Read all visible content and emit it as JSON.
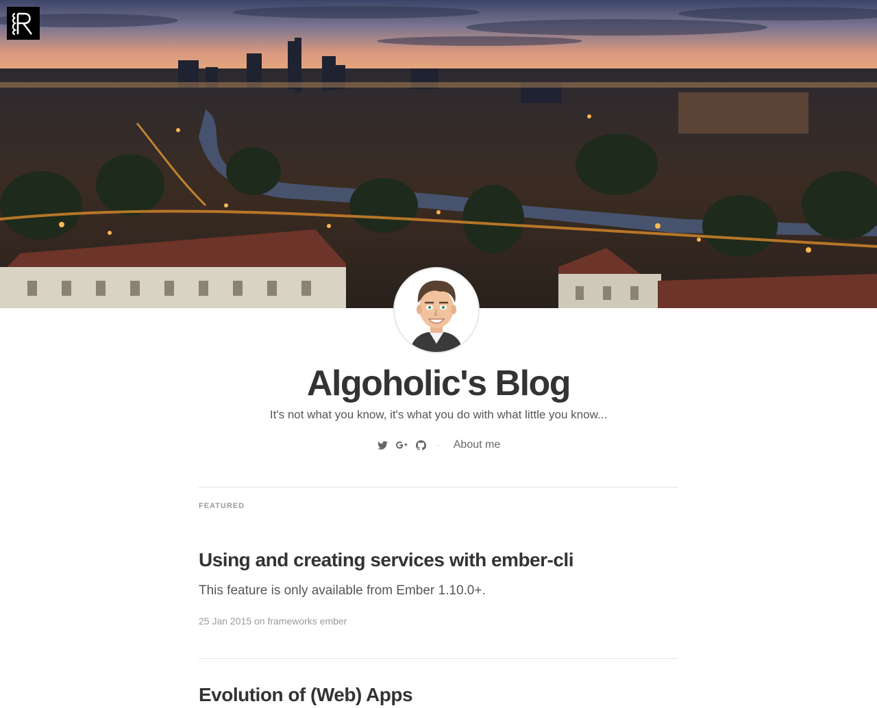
{
  "header": {
    "logo_letter": "R",
    "title": "Algoholic's Blog",
    "description": "It's not what you know, it's what you do with what little you know...",
    "social": [
      {
        "icon": "twitter-icon"
      },
      {
        "icon": "google-plus-icon"
      },
      {
        "icon": "github-icon"
      }
    ],
    "separator": "·",
    "about_label": "About me"
  },
  "posts": [
    {
      "label": "FEATURED",
      "title": "Using and creating services with ember-cli",
      "excerpt": "This feature is only available from Ember 1.10.0+.",
      "date": "25 Jan 2015",
      "on_word": "on",
      "tags": [
        "frameworks",
        "ember"
      ]
    },
    {
      "title": "Evolution of (Web) Apps"
    }
  ],
  "colors": {
    "text": "#333333",
    "muted": "#9a9a9a",
    "divider": "#e3e3e3"
  }
}
